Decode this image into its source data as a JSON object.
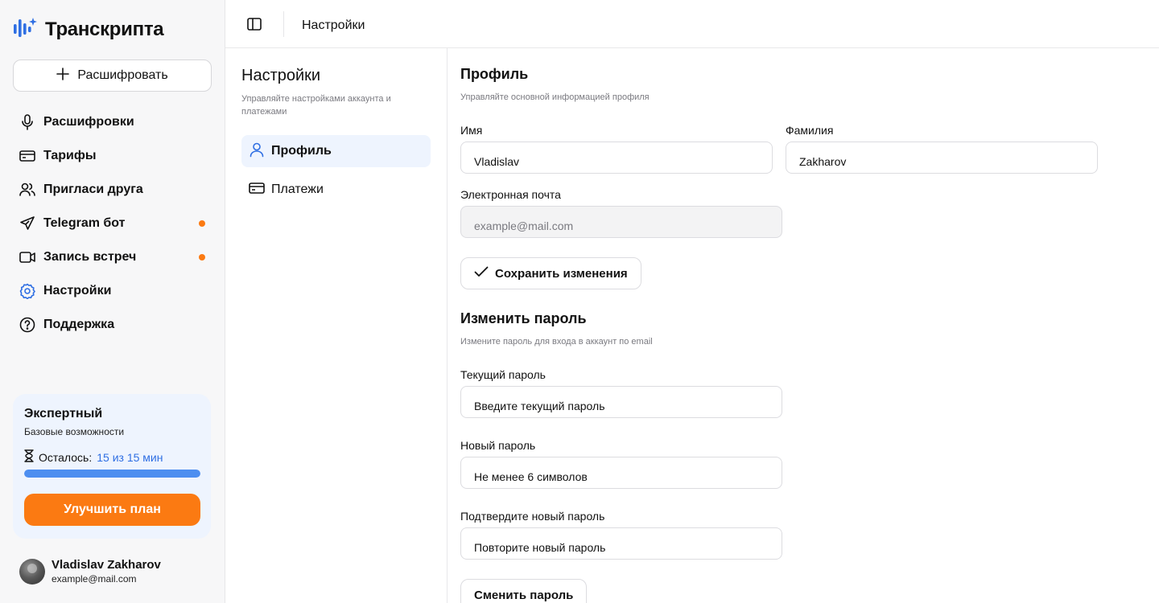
{
  "brand": {
    "name": "Транскрипта",
    "icon": "soundwave-sparkle-logo",
    "accent": "#2f6fe3"
  },
  "sidebar": {
    "new_button_label": "Расшифровать",
    "items": [
      {
        "label": "Расшифровки",
        "icon": "microphone-icon",
        "dot": false
      },
      {
        "label": "Тарифы",
        "icon": "credit-card-icon",
        "dot": false
      },
      {
        "label": "Пригласи друга",
        "icon": "users-icon",
        "dot": false
      },
      {
        "label": "Telegram бот",
        "icon": "send-icon",
        "dot": true
      },
      {
        "label": "Запись встреч",
        "icon": "video-icon",
        "dot": true
      },
      {
        "label": "Настройки",
        "icon": "gear-icon",
        "dot": false,
        "active": true
      },
      {
        "label": "Поддержка",
        "icon": "help-circle-icon",
        "dot": false
      }
    ],
    "dot_color": "#fb7a12"
  },
  "plan": {
    "title": "Экспертный",
    "subtitle": "Базовые возможности",
    "remaining_label": "Осталось:",
    "remaining_value": "15 из 15 мин",
    "progress": 1.0,
    "upgrade_label": "Улучшить план",
    "upgrade_color": "#fb7a12"
  },
  "user": {
    "name": "Vladislav Zakharov",
    "email": "example@mail.com"
  },
  "header": {
    "title": "Настройки"
  },
  "settings": {
    "title": "Настройки",
    "subtitle": "Управляйте настройками аккаунта и платежами",
    "menu": [
      {
        "label": "Профиль",
        "icon": "user-icon",
        "active": true
      },
      {
        "label": "Платежи",
        "icon": "credit-card-icon",
        "active": false
      }
    ]
  },
  "profile": {
    "title": "Профиль",
    "subtitle": "Управляйте основной информацией профиля",
    "first_name_label": "Имя",
    "first_name_value": "Vladislav",
    "last_name_label": "Фамилия",
    "last_name_value": "Zakharov",
    "email_label": "Электронная почта",
    "email_value": "example@mail.com",
    "save_label": "Сохранить изменения"
  },
  "password": {
    "title": "Изменить пароль",
    "subtitle": "Измените пароль для входа в аккаунт по email",
    "current_label": "Текущий пароль",
    "current_placeholder": "Введите текущий пароль",
    "new_label": "Новый пароль",
    "new_placeholder": "Не менее 6 символов",
    "confirm_label": "Подтвердите новый пароль",
    "confirm_placeholder": "Повторите новый пароль",
    "submit_label": "Сменить пароль"
  }
}
